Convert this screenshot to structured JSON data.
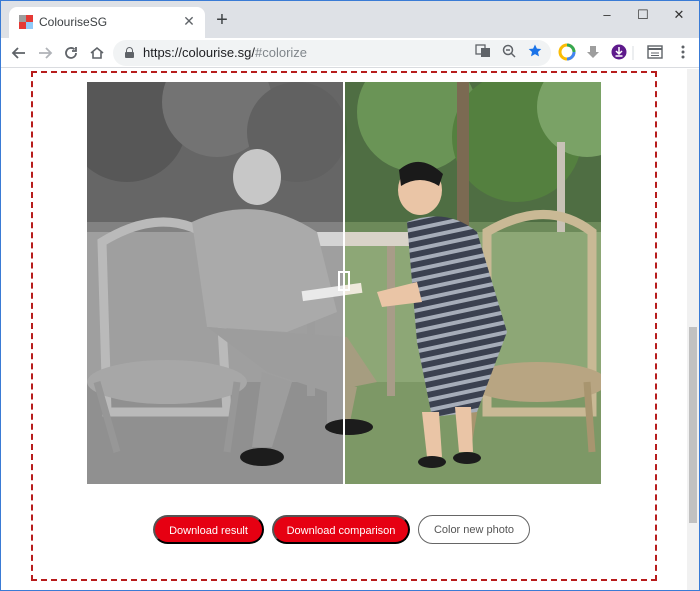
{
  "browser": {
    "tab": {
      "title": "ColouriseSG"
    },
    "new_tab_symbol": "+",
    "window_controls": {
      "minimize": "–",
      "maximize": "☐",
      "close": "✕"
    },
    "url": {
      "main": "https://colourise.sg/",
      "hash": "#colorize"
    }
  },
  "page": {
    "buttons": {
      "download_result": "Download result",
      "download_comparison": "Download comparison",
      "color_new_photo": "Color new photo"
    },
    "comparison_split_fraction": 0.5
  },
  "colors": {
    "accent": "#e60012",
    "dashed_border": "#b71c1c",
    "star": "#1a73e8"
  }
}
